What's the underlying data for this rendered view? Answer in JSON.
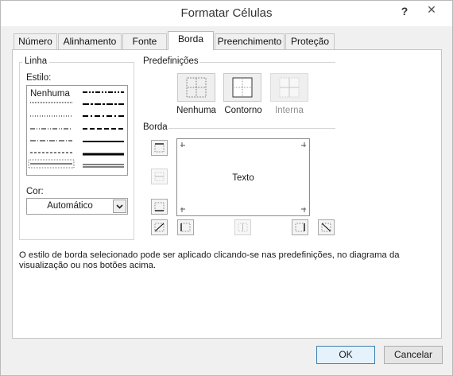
{
  "window": {
    "title": "Formatar Células",
    "help": "?",
    "close": "✕"
  },
  "tabs": [
    {
      "label": "Número"
    },
    {
      "label": "Alinhamento"
    },
    {
      "label": "Fonte"
    },
    {
      "label": "Borda",
      "active": true
    },
    {
      "label": "Preenchimento"
    },
    {
      "label": "Proteção"
    }
  ],
  "line_group": {
    "title": "Linha",
    "style_label": "Estilo:",
    "style_none": "Nenhuma",
    "color_label": "Cor:",
    "color_value": "Automático"
  },
  "presets_group": {
    "title": "Predefinições",
    "items": [
      {
        "label": "Nenhuma",
        "enabled": true
      },
      {
        "label": "Contorno",
        "enabled": true
      },
      {
        "label": "Interna",
        "enabled": false
      }
    ]
  },
  "border_group": {
    "title": "Borda",
    "preview_text": "Texto"
  },
  "description": "O estilo de borda selecionado pode ser aplicado clicando-se nas predefinições, no diagrama da visualização ou nos botões acima.",
  "footer": {
    "ok": "OK",
    "cancel": "Cancelar"
  },
  "colors": {
    "accent": "#3c7fb1",
    "panel": "#ffffff",
    "chrome": "#f0f0f0"
  }
}
